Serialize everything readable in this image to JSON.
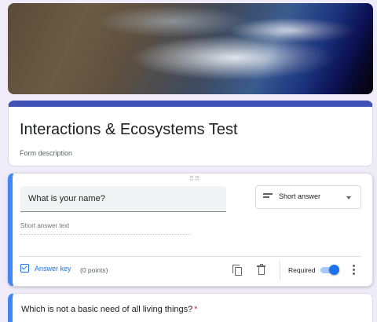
{
  "header": {
    "image_description": "Earth from space"
  },
  "form": {
    "title": "Interactions & Ecosystems Test",
    "description_placeholder": "Form description"
  },
  "question1": {
    "title": "What is your name?",
    "type_label": "Short answer",
    "answer_placeholder": "Short answer text",
    "answer_key_label": "Answer key",
    "points_label": "(0 points)",
    "required_label": "Required",
    "required": true
  },
  "question2": {
    "title": "Which is not a basic need of all living things?",
    "required_mark": "*"
  },
  "colors": {
    "accent": "#3f51b5",
    "active_border": "#4285f4",
    "link": "#1a73e8",
    "required": "#d93025",
    "background": "#f0ebf8"
  }
}
